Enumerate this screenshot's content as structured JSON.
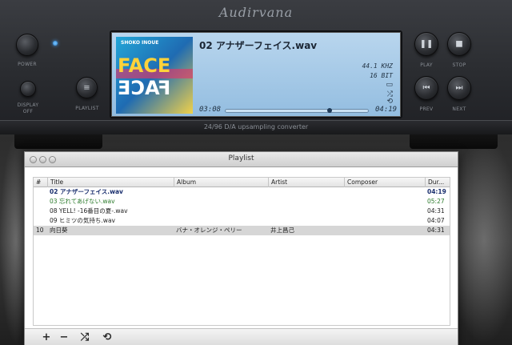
{
  "player": {
    "brand": "Audirvana",
    "caption": "24/96 D/A upsampling converter",
    "buttons": {
      "power": "POWER",
      "display_off_line1": "DISPLAY",
      "display_off_line2": "OFF",
      "playlist": "PLAYLIST",
      "play": "PLAY",
      "stop": "STOP",
      "prev": "PREV",
      "next": "NEXT"
    },
    "lcd": {
      "track_title": "02 アナザーフェイス.wav",
      "sample_rate": "44.1 KHZ",
      "bit_depth": "16 BIT",
      "elapsed": "03:08",
      "duration": "04:19",
      "progress": 0.72,
      "art_text_top": "FACE",
      "art_text_bottom": "FACE",
      "art_artist": "SHOKO INOUE"
    }
  },
  "playlist_window": {
    "title": "Playlist",
    "columns": [
      "#",
      "Title",
      "Album",
      "Artist",
      "Composer",
      "Dur..."
    ],
    "rows": [
      {
        "num": "",
        "title": "02 アナザーフェイス.wav",
        "album": "",
        "artist": "",
        "composer": "",
        "duration": "04:19",
        "state": "playing"
      },
      {
        "num": "",
        "title": "03 忘れてあげない.wav",
        "album": "",
        "artist": "",
        "composer": "",
        "duration": "05:27",
        "state": "queued"
      },
      {
        "num": "",
        "title": "08 YELL! -16番目の夏-.wav",
        "album": "",
        "artist": "",
        "composer": "",
        "duration": "04:31",
        "state": "normal"
      },
      {
        "num": "",
        "title": "09 ヒミツの気持ち.wav",
        "album": "",
        "artist": "",
        "composer": "",
        "duration": "04:07",
        "state": "normal"
      },
      {
        "num": "10",
        "title": "向日葵",
        "album": "バナ・オレンジ・ペリー",
        "artist": "井上昌己",
        "composer": "",
        "duration": "04:31",
        "state": "selected"
      }
    ],
    "toolbar": {
      "add": "+",
      "remove": "−",
      "shuffle": "⤮",
      "repeat": "⟲"
    }
  },
  "colors": {
    "playing_text": "#1a2f6e",
    "queued_text": "#2b7a2b",
    "normal_text": "#222222",
    "selected_row": "#d6d6d6",
    "lcd_background": "#a9cdea"
  }
}
